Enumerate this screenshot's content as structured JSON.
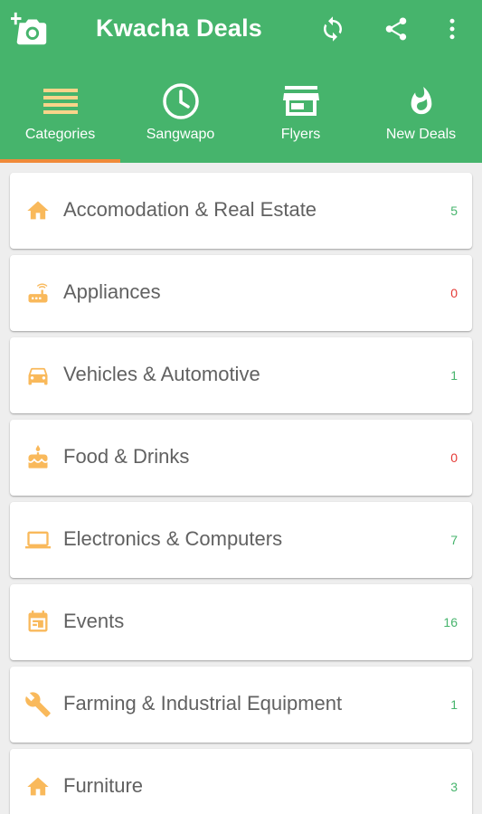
{
  "app": {
    "title": "Kwacha Deals"
  },
  "toolbar": {
    "add_photo_icon": "add-photo-icon",
    "refresh_icon": "refresh-icon",
    "share_icon": "share-icon",
    "more_icon": "more-vertical-icon"
  },
  "tabs": [
    {
      "label": "Categories",
      "icon": "list-icon",
      "selected": true
    },
    {
      "label": "Sangwapo",
      "icon": "clock-icon"
    },
    {
      "label": "Flyers",
      "icon": "store-icon"
    },
    {
      "label": "New Deals",
      "icon": "fire-icon"
    }
  ],
  "colors": {
    "primary": "#46b46c",
    "indicator": "#f08a3a",
    "category_icon": "#f9b95b",
    "count_positive": "#46b46c",
    "count_zero": "#e53935"
  },
  "categories": [
    {
      "label": "Accomodation & Real Estate",
      "count": "5",
      "icon": "home-icon"
    },
    {
      "label": "Appliances",
      "count": "0",
      "icon": "router-icon"
    },
    {
      "label": "Vehicles & Automotive",
      "count": "1",
      "icon": "car-icon"
    },
    {
      "label": "Food & Drinks",
      "count": "0",
      "icon": "cake-icon"
    },
    {
      "label": "Electronics & Computers",
      "count": "7",
      "icon": "laptop-icon"
    },
    {
      "label": "Events",
      "count": "16",
      "icon": "calendar-icon"
    },
    {
      "label": "Farming & Industrial Equipment",
      "count": "1",
      "icon": "wrench-icon"
    },
    {
      "label": "Furniture",
      "count": "3",
      "icon": "home-icon"
    }
  ]
}
